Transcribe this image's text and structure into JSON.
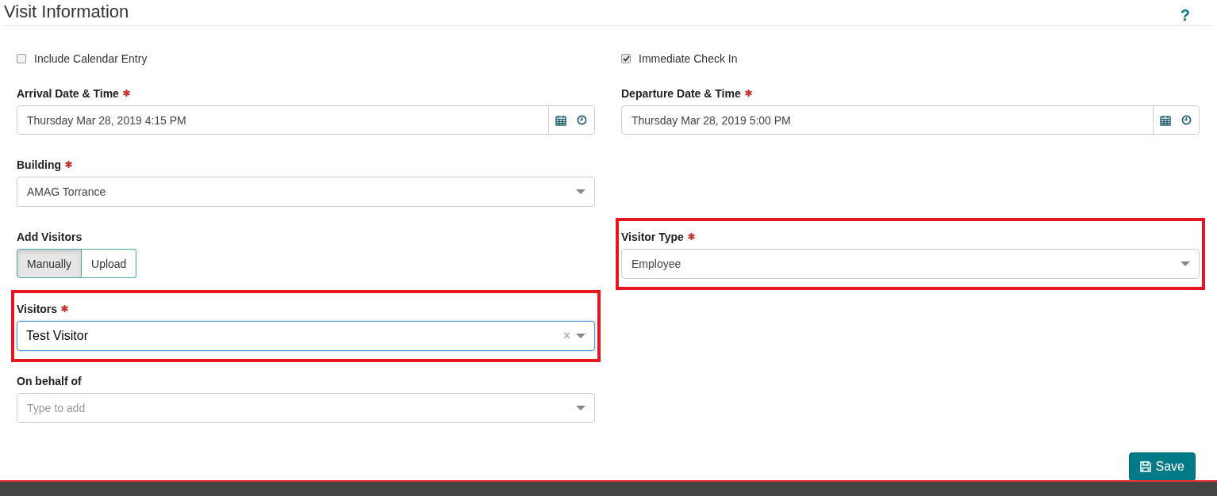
{
  "header": {
    "title": "Visit Information",
    "help": "?"
  },
  "options": [
    {
      "label": "Include Calendar Entry",
      "checked": false
    },
    {
      "label": "Immediate Check In",
      "checked": true
    }
  ],
  "arrival": {
    "label": "Arrival Date & Time",
    "required": true,
    "value": "Thursday Mar 28, 2019 4:15 PM"
  },
  "departure": {
    "label": "Departure Date & Time",
    "required": true,
    "value": "Thursday Mar 28, 2019 5:00 PM"
  },
  "building": {
    "label": "Building",
    "required": true,
    "value": "AMAG Torrance"
  },
  "add_visitors": {
    "label": "Add Visitors",
    "options": [
      {
        "label": "Manually",
        "selected": true
      },
      {
        "label": "Upload",
        "selected": false
      }
    ]
  },
  "visitor_type": {
    "label": "Visitor Type",
    "required": true,
    "value": "Employee",
    "highlighted": true
  },
  "visitors": {
    "label": "Visitors",
    "required": true,
    "value": "Test Visitor",
    "clear": "×",
    "focused": true,
    "highlighted": true
  },
  "on_behalf": {
    "label": "On behalf of",
    "required": false,
    "placeholder": "Type to add"
  },
  "save_button": {
    "label": "Save"
  }
}
